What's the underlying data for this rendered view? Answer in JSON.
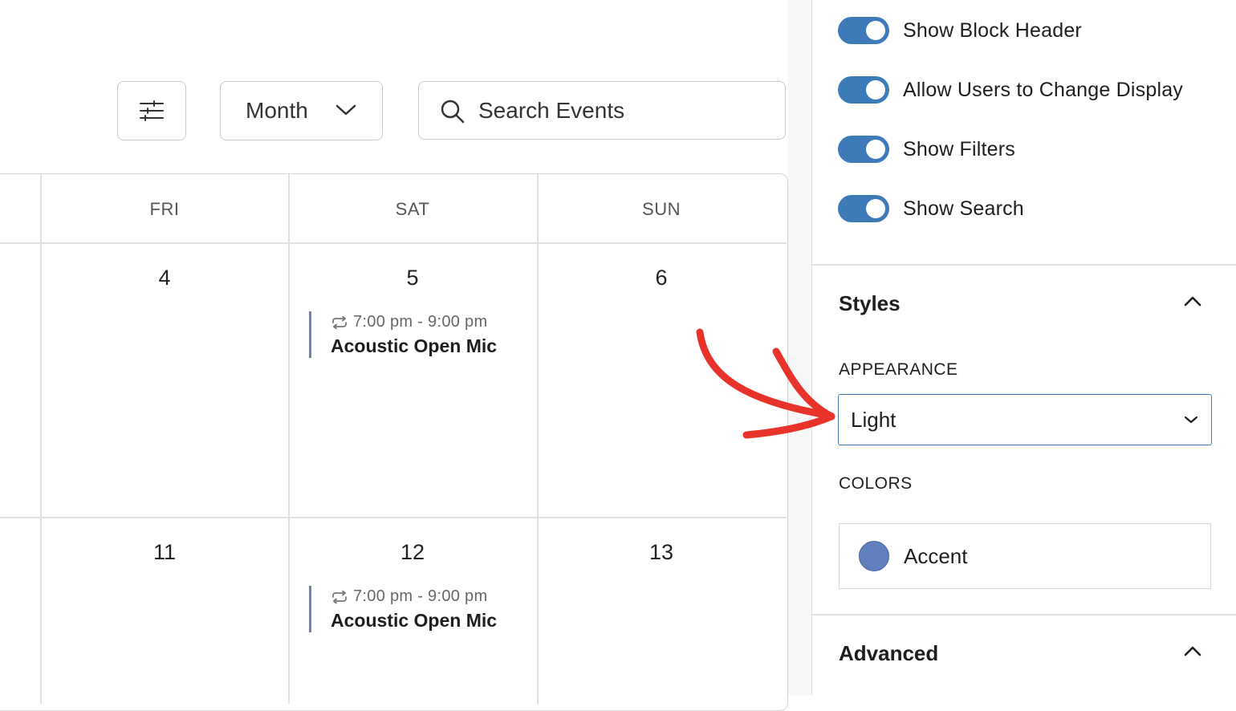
{
  "toolbar": {
    "filter_icon": "sliders-icon",
    "view_select": {
      "selected": "Month",
      "icon": "chevron-down-icon"
    },
    "search": {
      "placeholder": "Search Events",
      "icon": "search-icon"
    }
  },
  "calendar": {
    "weekdays": [
      "FRI",
      "SAT",
      "SUN"
    ],
    "weeks": [
      {
        "days": [
          "4",
          "5",
          "6"
        ],
        "events": [
          {
            "day": "5",
            "time": "7:00 pm - 9:00 pm",
            "title": "Acoustic Open Mic",
            "recurring": true
          }
        ]
      },
      {
        "days": [
          "11",
          "12",
          "13"
        ],
        "events": [
          {
            "day": "12",
            "time": "7:00 pm - 9:00 pm",
            "title": "Acoustic Open Mic",
            "recurring": true
          }
        ]
      }
    ],
    "event_accent_color": "#6b82b8"
  },
  "settings": {
    "toggles": [
      {
        "label": "Show Block Header",
        "on": true
      },
      {
        "label": "Allow Users to Change Display",
        "on": true
      },
      {
        "label": "Show Filters",
        "on": true
      },
      {
        "label": "Show Search",
        "on": true
      }
    ],
    "toggle_color": "#3c7ab8",
    "styles": {
      "title": "Styles",
      "expanded": true,
      "appearance_label": "APPEARANCE",
      "appearance_value": "Light",
      "colors_label": "COLORS",
      "colors": [
        {
          "label": "Accent",
          "swatch": "#5f7fbf"
        }
      ]
    },
    "advanced": {
      "title": "Advanced",
      "expanded": true
    }
  },
  "annotation": {
    "type": "hand-drawn arrow",
    "color": "#e8332a",
    "points_to": "appearance-select"
  }
}
